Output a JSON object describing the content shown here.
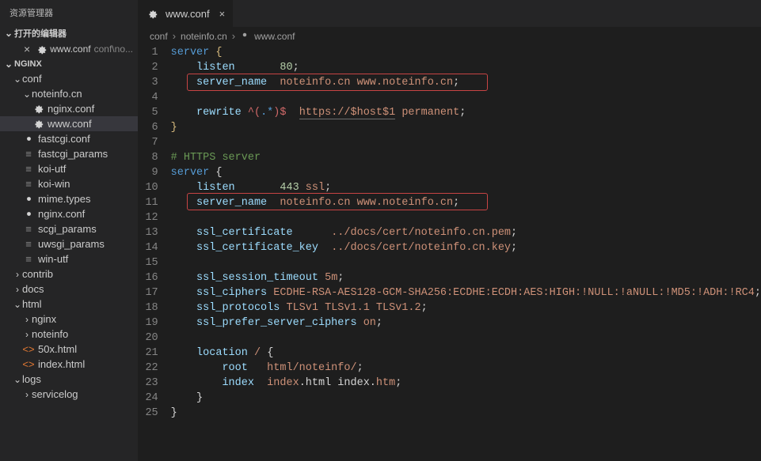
{
  "explorer": {
    "title": "资源管理器",
    "openEditors": {
      "label": "打开的编辑器",
      "items": [
        {
          "name": "www.conf",
          "context": "conf\\no..."
        }
      ]
    },
    "workspace": "NGINX",
    "tree": {
      "conf": "conf",
      "noteinfo": "noteinfo.cn",
      "nginxconf": "nginx.conf",
      "wwwconf": "www.conf",
      "fastcgiconf": "fastcgi.conf",
      "fastcgiparams": "fastcgi_params",
      "koiutf": "koi-utf",
      "koiwin": "koi-win",
      "mimetypes": "mime.types",
      "nginxconf2": "nginx.conf",
      "scgiparams": "scgi_params",
      "uwsgiparams": "uwsgi_params",
      "winutf": "win-utf",
      "contrib": "contrib",
      "docs": "docs",
      "html": "html",
      "nginxdir": "nginx",
      "noteinfodir": "noteinfo",
      "50x": "50x.html",
      "indexhtml": "index.html",
      "logs": "logs",
      "servicelog": "servicelog"
    }
  },
  "tabs": {
    "active": {
      "name": "www.conf"
    }
  },
  "breadcrumb": {
    "parts": [
      "conf",
      "noteinfo.cn",
      "www.conf"
    ]
  },
  "code": {
    "l1": {
      "a": "server",
      "b": "{"
    },
    "l2": {
      "a": "listen",
      "b": "80",
      "c": ";"
    },
    "l3": {
      "a": "server_name",
      "b": "noteinfo.cn www.noteinfo.cn",
      "c": ";"
    },
    "l5": {
      "a": "rewrite",
      "b": "^(",
      "c": ".*",
      "d": ")$",
      "e": "https://$host$1",
      "f": "permanent",
      "g": ";"
    },
    "l6": {
      "a": "}"
    },
    "l8": {
      "a": "# HTTPS server"
    },
    "l9": {
      "a": "server",
      "b": "{"
    },
    "l10": {
      "a": "listen",
      "b": "443",
      "c": "ssl",
      "d": ";"
    },
    "l11": {
      "a": "server_name",
      "b": "noteinfo.cn www.noteinfo.cn",
      "c": ";"
    },
    "l13": {
      "a": "ssl_certificate",
      "b": "../docs/cert/noteinfo.cn.pem",
      "c": ";"
    },
    "l14": {
      "a": "ssl_certificate_key",
      "b": "../docs/cert/noteinfo.cn.key",
      "c": ";"
    },
    "l16": {
      "a": "ssl_session_timeout",
      "b": "5m",
      "c": ";"
    },
    "l17": {
      "a": "ssl_ciphers",
      "b": "ECDHE-RSA-AES128-GCM-SHA256:ECDHE:ECDH:AES:HIGH:!NULL:!aNULL:!MD5:!ADH:!RC4",
      "c": ";"
    },
    "l18": {
      "a": "ssl_protocols",
      "b": "TLSv1 TLSv1.1 TLSv1.2",
      "c": ";"
    },
    "l19": {
      "a": "ssl_prefer_server_ciphers",
      "b": "on",
      "c": ";"
    },
    "l21": {
      "a": "location",
      "b": "/",
      "c": "{"
    },
    "l22": {
      "a": "root",
      "b": "html/noteinfo/",
      "c": ";"
    },
    "l23": {
      "a": "index",
      "b": "index",
      "c": ".html index.",
      "d": "htm",
      "e": ";"
    },
    "l24": {
      "a": "}"
    },
    "l25": {
      "a": "}"
    }
  }
}
